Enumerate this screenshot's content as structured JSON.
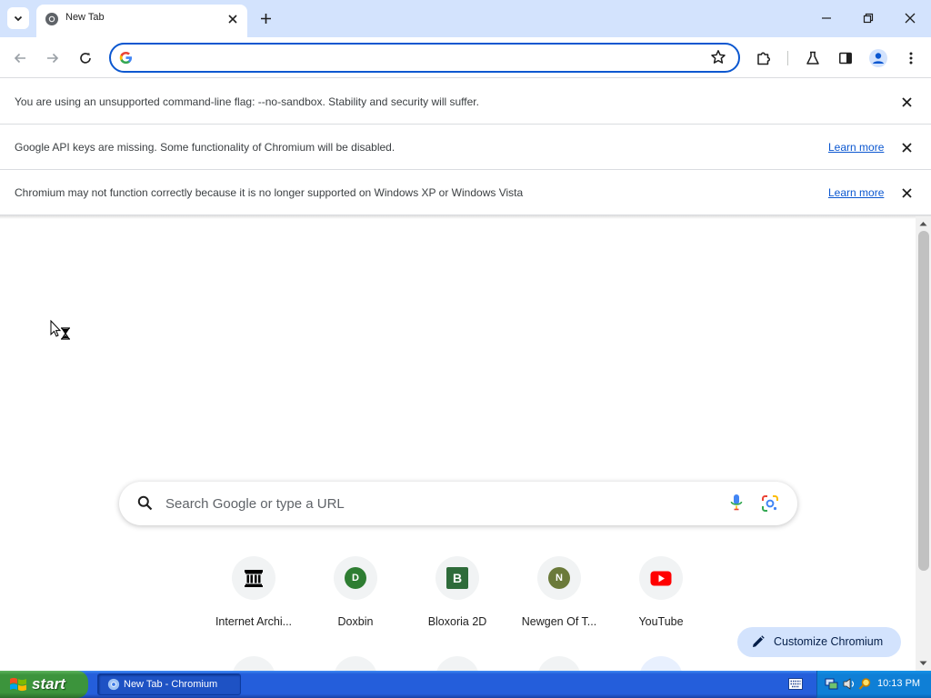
{
  "window": {
    "tab_title": "New Tab"
  },
  "omnibox": {
    "value": "",
    "placeholder": ""
  },
  "infobars": [
    {
      "message": "You are using an unsupported command-line flag: --no-sandbox. Stability and security will suffer.",
      "link": ""
    },
    {
      "message": "Google API keys are missing. Some functionality of Chromium will be disabled.",
      "link": "Learn more"
    },
    {
      "message": "Chromium may not function correctly because it is no longer supported on Windows XP or Windows Vista",
      "link": "Learn more"
    }
  ],
  "ntp": {
    "search_placeholder": "Search Google or type a URL",
    "shortcuts": [
      {
        "label": "Internet Archi...",
        "icon": "internet-archive-icon"
      },
      {
        "label": "Doxbin",
        "icon": "D",
        "color": "#2e7d32"
      },
      {
        "label": "Bloxoria 2D",
        "icon": "B",
        "color": "#2e6b3a"
      },
      {
        "label": "Newgen Of T...",
        "icon": "N",
        "color": "#6b7a3a"
      },
      {
        "label": "YouTube",
        "icon": "youtube-icon",
        "color": "#ff0000"
      }
    ],
    "customize_label": "Customize Chromium"
  },
  "taskbar": {
    "start_label": "start",
    "task_label": "New Tab - Chromium",
    "clock": "10:13 PM"
  },
  "colors": {
    "accent": "#0b57d0",
    "tabstrip": "#d3e3fd",
    "taskbar": "#245edb",
    "start": "#3c943c"
  }
}
